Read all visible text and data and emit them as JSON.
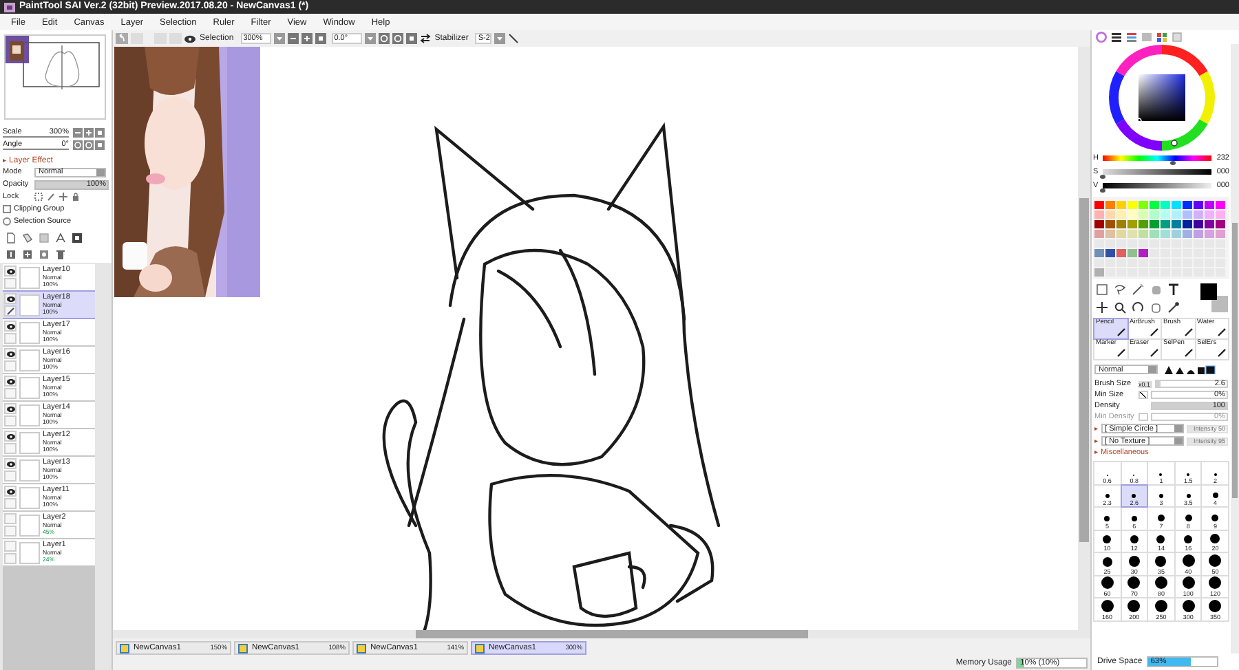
{
  "window": {
    "title": "PaintTool SAI Ver.2 (32bit) Preview.2017.08.20 - NewCanvas1 (*)"
  },
  "menu": [
    "File",
    "Edit",
    "Canvas",
    "Layer",
    "Selection",
    "Ruler",
    "Filter",
    "View",
    "Window",
    "Help"
  ],
  "toolbar": {
    "selection_label": "Selection",
    "zoom": "300%",
    "angle": "0.0°",
    "stabilizer_label": "Stabilizer",
    "stabilizer": "S-2"
  },
  "navigator": {
    "scale_label": "Scale",
    "scale": "300%",
    "angle_label": "Angle",
    "angle": "0°"
  },
  "layer_effect": {
    "expander": "▸",
    "label": "Layer Effect"
  },
  "layer_props": {
    "mode_label": "Mode",
    "mode": "Normal",
    "opacity_label": "Opacity",
    "opacity": "100%",
    "level": 1,
    "lock_label": "Lock",
    "options": [
      {
        "label": "Clipping Group",
        "kind": "check",
        "checked": false
      },
      {
        "label": "Selection Source",
        "kind": "radio",
        "checked": false
      }
    ]
  },
  "layers": [
    {
      "name": "Layer10",
      "mode": "Normal",
      "opacity": "100%",
      "visible": true,
      "selected": false,
      "reduced": false
    },
    {
      "name": "Layer18",
      "mode": "Normal",
      "opacity": "100%",
      "visible": true,
      "selected": true,
      "reduced": false
    },
    {
      "name": "Layer17",
      "mode": "Normal",
      "opacity": "100%",
      "visible": true,
      "selected": false,
      "reduced": false
    },
    {
      "name": "Layer16",
      "mode": "Normal",
      "opacity": "100%",
      "visible": true,
      "selected": false,
      "reduced": false
    },
    {
      "name": "Layer15",
      "mode": "Normal",
      "opacity": "100%",
      "visible": true,
      "selected": false,
      "reduced": false
    },
    {
      "name": "Layer14",
      "mode": "Normal",
      "opacity": "100%",
      "visible": true,
      "selected": false,
      "reduced": false
    },
    {
      "name": "Layer12",
      "mode": "Normal",
      "opacity": "100%",
      "visible": true,
      "selected": false,
      "reduced": false
    },
    {
      "name": "Layer13",
      "mode": "Normal",
      "opacity": "100%",
      "visible": true,
      "selected": false,
      "reduced": false
    },
    {
      "name": "Layer11",
      "mode": "Normal",
      "opacity": "100%",
      "visible": true,
      "selected": false,
      "reduced": false
    },
    {
      "name": "Layer2",
      "mode": "Normal",
      "opacity": "45%",
      "visible": false,
      "selected": false,
      "reduced": true
    },
    {
      "name": "Layer1",
      "mode": "Normal",
      "opacity": "24%",
      "visible": false,
      "selected": false,
      "reduced": true
    }
  ],
  "color": {
    "sliders": [
      {
        "label": "H",
        "value": "232",
        "level": 0.644,
        "kind": "hue"
      },
      {
        "label": "S",
        "value": "000",
        "level": 0,
        "kind": "sat"
      },
      {
        "label": "V",
        "value": "000",
        "level": 0,
        "kind": "val"
      }
    ],
    "palette": {
      "rows": [
        [
          {
            "color": "#ff0000"
          },
          {
            "color": "#ff8000"
          },
          {
            "color": "#ffd000"
          },
          {
            "color": "#ffff00"
          },
          {
            "color": "#80ff00"
          },
          {
            "color": "#00ff40"
          },
          {
            "color": "#00ffc0"
          },
          {
            "color": "#00e0ff"
          },
          {
            "color": "#0030ff"
          },
          {
            "color": "#6000ff"
          },
          {
            "color": "#c000ff"
          },
          {
            "color": "#ff00ff"
          }
        ],
        [
          {
            "color": "#ffb0b0"
          },
          {
            "color": "#ffd8b0"
          },
          {
            "color": "#fff0b0"
          },
          {
            "color": "#ffffc0"
          },
          {
            "color": "#d8ffb0"
          },
          {
            "color": "#b0ffc8"
          },
          {
            "color": "#b0fff0"
          },
          {
            "color": "#b0f0ff"
          },
          {
            "color": "#b0c0ff"
          },
          {
            "color": "#d0b0ff"
          },
          {
            "color": "#f0b0ff"
          },
          {
            "color": "#ffb0f0"
          }
        ],
        [
          {
            "color": "#a00000"
          },
          {
            "color": "#a05000"
          },
          {
            "color": "#a08000"
          },
          {
            "color": "#a0a000"
          },
          {
            "color": "#50a000"
          },
          {
            "color": "#00a030"
          },
          {
            "color": "#00a080"
          },
          {
            "color": "#0080a0"
          },
          {
            "color": "#0020a0"
          },
          {
            "color": "#4000a0"
          },
          {
            "color": "#8000a0"
          },
          {
            "color": "#a00080"
          }
        ],
        [
          {
            "color": "#e0a0a0"
          },
          {
            "color": "#e0c0a0"
          },
          {
            "color": "#e0d8a0"
          },
          {
            "color": "#e0e0b0"
          },
          {
            "color": "#c0e0a0"
          },
          {
            "color": "#a0e0b8"
          },
          {
            "color": "#a0e0d8"
          },
          {
            "color": "#a0d0e0"
          },
          {
            "color": "#a0b0e0"
          },
          {
            "color": "#c0a0e0"
          },
          {
            "color": "#d8a0e0"
          },
          {
            "color": "#e0a0d0"
          }
        ]
      ],
      "custom": [
        [
          {
            "color": "#7090b8"
          },
          {
            "color": "#3050a8"
          },
          {
            "color": "#e06060"
          },
          {
            "color": "#90c090"
          },
          {
            "color": "#b020c0"
          }
        ],
        [
          {
            "color": "#b0b0b0"
          }
        ]
      ]
    }
  },
  "brush_tools": [
    {
      "label": "Pencil",
      "selected": true
    },
    {
      "label": "AirBrush",
      "selected": false
    },
    {
      "label": "Brush",
      "selected": false
    },
    {
      "label": "Water",
      "selected": false
    },
    {
      "label": "Marker",
      "selected": false
    },
    {
      "label": "Eraser",
      "selected": false
    },
    {
      "label": "SelPen",
      "selected": false
    },
    {
      "label": "SelErs",
      "selected": false
    }
  ],
  "brush": {
    "blend": "Normal",
    "settings": [
      {
        "label": "Brush Size",
        "kind": "size",
        "multiplier": "x0.1",
        "value": "2.6",
        "level": 0.05
      },
      {
        "label": "Min Size",
        "kind": "check",
        "checked": true,
        "value": "0%",
        "level": 0
      },
      {
        "label": "Density",
        "kind": "bar",
        "value": "100",
        "level": 1
      },
      {
        "label": "Min Density",
        "kind": "check",
        "checked": false,
        "value": "0%",
        "level": 0,
        "disabled": true
      }
    ],
    "options": [
      {
        "expander": "▸",
        "label": "[ Simple Circle ]",
        "intensity": "Intensity 50",
        "level": 0.5
      },
      {
        "expander": "▸",
        "label": "[ No Texture ]",
        "intensity": "Intensity 95",
        "level": 0.95
      }
    ],
    "misc_expander": "▸",
    "misc": "Miscellaneous"
  },
  "brush_sizes": [
    {
      "label": "0.6",
      "selected": false
    },
    {
      "label": "0.8",
      "selected": false
    },
    {
      "label": "1",
      "selected": false
    },
    {
      "label": "1.5",
      "selected": false
    },
    {
      "label": "2",
      "selected": false
    },
    {
      "label": "2.3",
      "selected": false
    },
    {
      "label": "2.6",
      "selected": true
    },
    {
      "label": "3",
      "selected": false
    },
    {
      "label": "3.5",
      "selected": false
    },
    {
      "label": "4",
      "selected": false
    },
    {
      "label": "5",
      "selected": false
    },
    {
      "label": "6",
      "selected": false
    },
    {
      "label": "7",
      "selected": false
    },
    {
      "label": "8",
      "selected": false
    },
    {
      "label": "9",
      "selected": false
    },
    {
      "label": "10",
      "selected": false
    },
    {
      "label": "12",
      "selected": false
    },
    {
      "label": "14",
      "selected": false
    },
    {
      "label": "16",
      "selected": false
    },
    {
      "label": "20",
      "selected": false
    },
    {
      "label": "25",
      "selected": false
    },
    {
      "label": "30",
      "selected": false
    },
    {
      "label": "35",
      "selected": false
    },
    {
      "label": "40",
      "selected": false
    },
    {
      "label": "50",
      "selected": false
    },
    {
      "label": "60",
      "selected": false
    },
    {
      "label": "70",
      "selected": false
    },
    {
      "label": "80",
      "selected": false
    },
    {
      "label": "100",
      "selected": false
    },
    {
      "label": "120",
      "selected": false
    },
    {
      "label": "160",
      "selected": false
    },
    {
      "label": "200",
      "selected": false
    },
    {
      "label": "250",
      "selected": false
    },
    {
      "label": "300",
      "selected": false
    },
    {
      "label": "350",
      "selected": false
    }
  ],
  "canvas_tabs": [
    {
      "name": "NewCanvas1",
      "zoom": "150%",
      "selected": false
    },
    {
      "name": "NewCanvas1",
      "zoom": "108%",
      "selected": false
    },
    {
      "name": "NewCanvas1",
      "zoom": "141%",
      "selected": false
    },
    {
      "name": "NewCanvas1",
      "zoom": "300%",
      "selected": true
    }
  ],
  "status": {
    "memory": {
      "label": "Memory Usage",
      "value": "10% (10%)",
      "level": 0.1
    },
    "drive": {
      "label": "Drive Space",
      "value": "63%",
      "level": 0.63
    }
  }
}
